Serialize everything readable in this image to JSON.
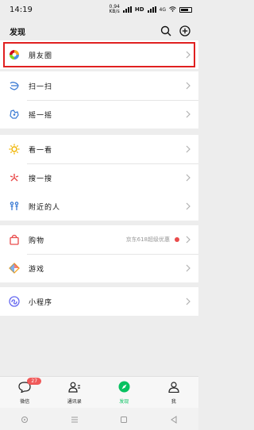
{
  "status_bar": {
    "time": "14:19",
    "net_speed": "0.94\nKB/s",
    "network_type": "HD",
    "signal_text": "4G"
  },
  "header": {
    "title": "发现",
    "search_icon": "search-icon",
    "add_icon": "plus-circle-icon"
  },
  "groups": [
    {
      "items": [
        {
          "label": "朋友圈",
          "icon": "moments-icon",
          "highlighted": true
        }
      ]
    },
    {
      "items": [
        {
          "label": "扫一扫",
          "icon": "scan-icon"
        },
        {
          "label": "摇一摇",
          "icon": "shake-icon"
        }
      ]
    },
    {
      "items": [
        {
          "label": "看一看",
          "icon": "top-stories-icon"
        },
        {
          "label": "搜一搜",
          "icon": "search-feature-icon"
        }
      ]
    },
    {
      "items": [
        {
          "label": "附近的人",
          "icon": "people-nearby-icon"
        }
      ]
    },
    {
      "items": [
        {
          "label": "购物",
          "icon": "shopping-bag-icon",
          "extra": "京东618超级优惠",
          "dot_color": "#e94b4b"
        },
        {
          "label": "游戏",
          "icon": "games-icon"
        }
      ]
    },
    {
      "items": [
        {
          "label": "小程序",
          "icon": "mini-programs-icon"
        }
      ]
    }
  ],
  "tabs": [
    {
      "label": "微信",
      "icon": "chat-icon",
      "badge": "27"
    },
    {
      "label": "通讯录",
      "icon": "contacts-icon"
    },
    {
      "label": "发现",
      "icon": "discover-icon",
      "active": true
    },
    {
      "label": "我",
      "icon": "me-icon"
    }
  ],
  "colors": {
    "accent": "#07c160",
    "highlight": "#e02020",
    "badge": "#f05a5a"
  }
}
